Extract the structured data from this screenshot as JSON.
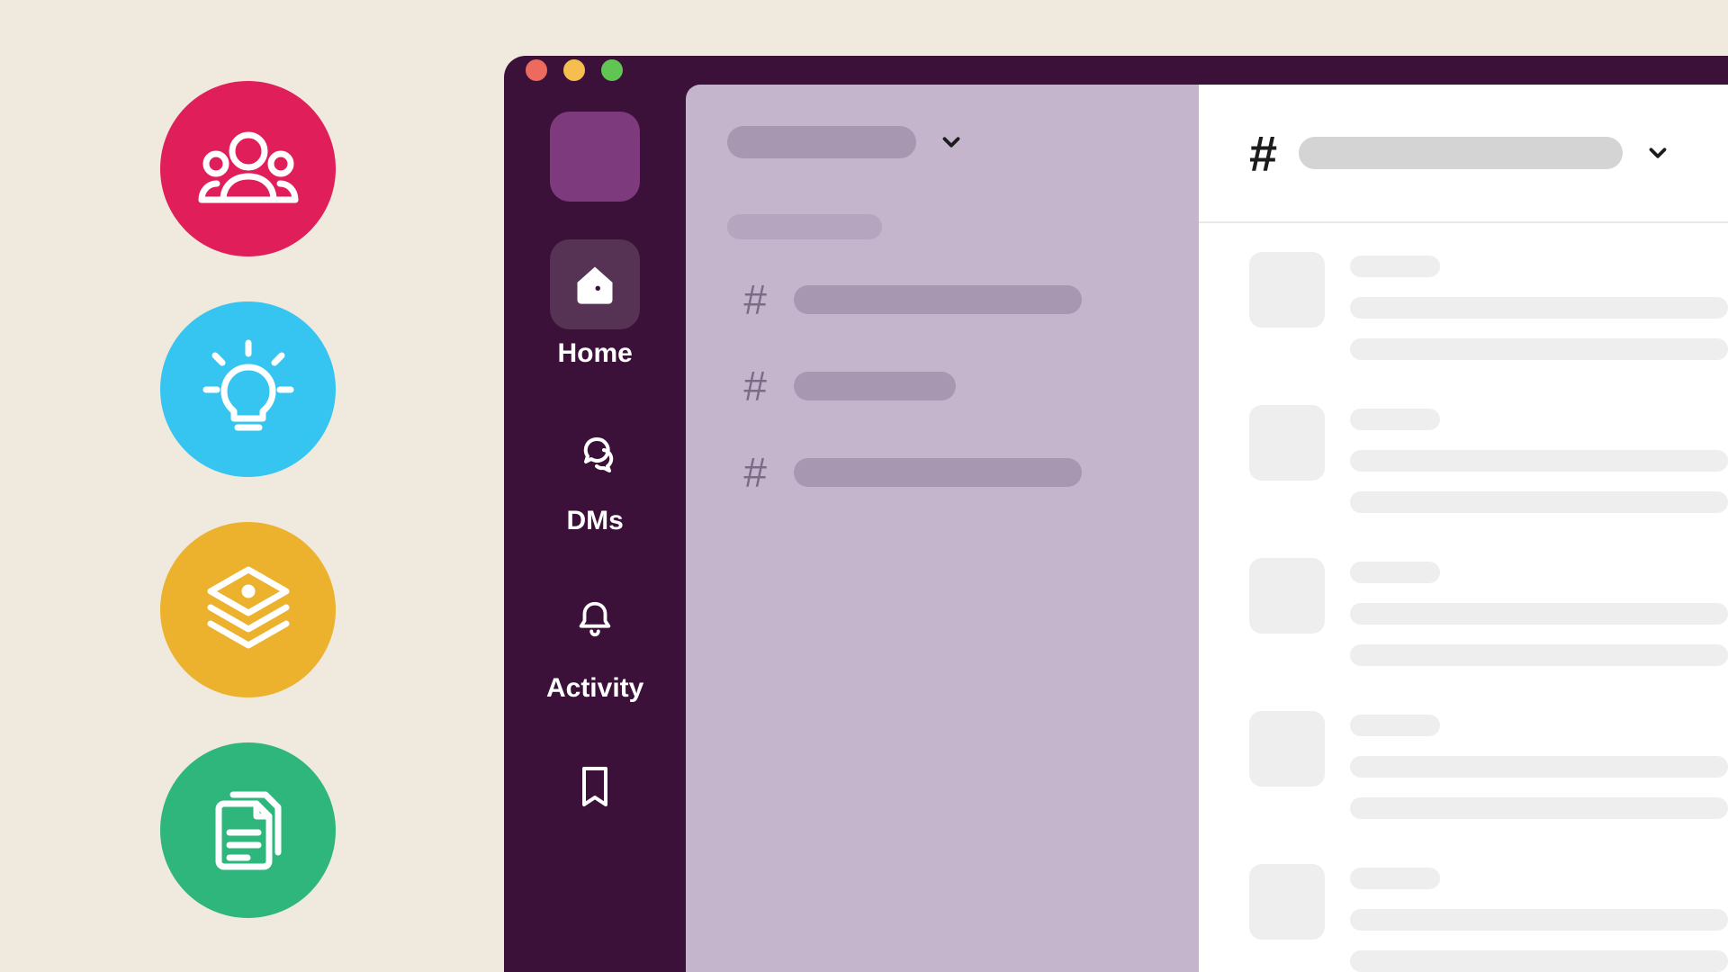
{
  "feature_badges": [
    {
      "icon": "people-icon",
      "color": "#e01e5a"
    },
    {
      "icon": "lightbulb-icon",
      "color": "#36c5f0"
    },
    {
      "icon": "layers-lock-icon",
      "color": "#ecb22e"
    },
    {
      "icon": "documents-icon",
      "color": "#2eb67d"
    }
  ],
  "window": {
    "traffic_lights": {
      "close": "#ec6a5e",
      "minimize": "#f5bf4f",
      "maximize": "#61c554"
    }
  },
  "rail": {
    "items": [
      {
        "key": "home",
        "label": "Home",
        "active": true
      },
      {
        "key": "dms",
        "label": "DMs",
        "active": false
      },
      {
        "key": "activity",
        "label": "Activity",
        "active": false
      },
      {
        "key": "later",
        "label": "",
        "active": false
      }
    ]
  },
  "sidebar": {
    "workspace_name_placeholder": "",
    "channels_section_label_placeholder": "",
    "channels": [
      {
        "prefix": "#",
        "label_placeholder": "",
        "length": "long"
      },
      {
        "prefix": "#",
        "label_placeholder": "",
        "length": "short"
      },
      {
        "prefix": "#",
        "label_placeholder": "",
        "length": "long"
      }
    ]
  },
  "main": {
    "channel_prefix": "#",
    "channel_name_placeholder": "",
    "messages": [
      {
        "author_placeholder": "",
        "lines": 2
      },
      {
        "author_placeholder": "",
        "lines": 2
      },
      {
        "author_placeholder": "",
        "lines": 2
      },
      {
        "author_placeholder": "",
        "lines": 2
      },
      {
        "author_placeholder": "",
        "lines": 2
      }
    ]
  }
}
